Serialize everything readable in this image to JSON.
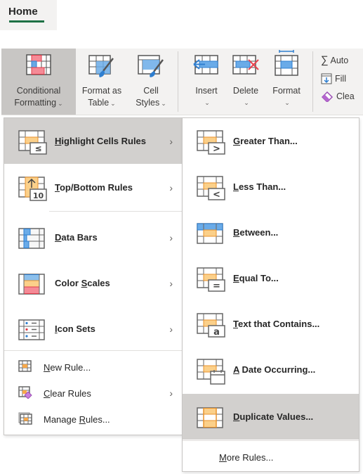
{
  "tabs": {
    "active_tab": "Home"
  },
  "ribbon": {
    "styles_group": [
      {
        "id": "conditional-formatting",
        "line1": "Conditional",
        "line2": "Formatting",
        "icon": "conditional-formatting-icon",
        "active": true
      },
      {
        "id": "format-as-table",
        "line1": "Format as",
        "line2": "Table",
        "icon": "format-as-table-icon"
      },
      {
        "id": "cell-styles",
        "line1": "Cell",
        "line2": "Styles",
        "icon": "cell-styles-icon"
      }
    ],
    "cells_group": [
      {
        "id": "insert",
        "label": "Insert",
        "icon": "insert-cells-icon"
      },
      {
        "id": "delete",
        "label": "Delete",
        "icon": "delete-cells-icon"
      },
      {
        "id": "format",
        "label": "Format",
        "icon": "format-cells-icon"
      }
    ],
    "editing_group": [
      {
        "id": "autosum",
        "label": "Auto",
        "icon": "sigma-icon"
      },
      {
        "id": "fill",
        "label": "Fill",
        "icon": "fill-down-icon"
      },
      {
        "id": "clear",
        "label": "Clea",
        "icon": "eraser-icon"
      }
    ],
    "dropdown_glyph": "⌄"
  },
  "conditional_menu": {
    "items": [
      {
        "pre": "",
        "u": "H",
        "post": "ighlight Cells Rules",
        "has_submenu": true,
        "highlighted": true,
        "icon": "highlight-cells-rules-icon"
      },
      {
        "pre": "",
        "u": "T",
        "post": "op/Bottom Rules",
        "has_submenu": true,
        "icon": "top-bottom-rules-icon"
      },
      {
        "pre": "",
        "u": "D",
        "post": "ata Bars",
        "has_submenu": true,
        "icon": "data-bars-icon"
      },
      {
        "pre": "Color ",
        "u": "S",
        "post": "cales",
        "has_submenu": true,
        "icon": "color-scales-icon"
      },
      {
        "pre": "",
        "u": "I",
        "post": "con Sets",
        "has_submenu": true,
        "icon": "icon-sets-icon"
      }
    ],
    "footer_items": [
      {
        "pre": "",
        "u": "N",
        "post": "ew Rule...",
        "has_submenu": false,
        "icon": "new-rule-icon"
      },
      {
        "pre": "",
        "u": "C",
        "post": "lear Rules",
        "has_submenu": true,
        "icon": "clear-rules-icon"
      },
      {
        "pre": "Manage ",
        "u": "R",
        "post": "ules...",
        "has_submenu": false,
        "icon": "manage-rules-icon"
      }
    ],
    "arrow_glyph": "›"
  },
  "highlight_submenu": {
    "items": [
      {
        "pre": "",
        "u": "G",
        "post": "reater Than...",
        "icon": "greater-than-icon",
        "symbol": ">"
      },
      {
        "pre": "",
        "u": "L",
        "post": "ess Than...",
        "icon": "less-than-icon",
        "symbol": "<"
      },
      {
        "pre": "",
        "u": "B",
        "post": "etween...",
        "icon": "between-icon",
        "symbol": ""
      },
      {
        "pre": "",
        "u": "E",
        "post": "qual To...",
        "icon": "equal-to-icon",
        "symbol": "="
      },
      {
        "pre": "",
        "u": "T",
        "post": "ext that Contains...",
        "icon": "text-contains-icon",
        "symbol": "a"
      },
      {
        "pre": "",
        "u": "A",
        "post": " Date Occurring...",
        "icon": "date-occurring-icon",
        "symbol": ""
      },
      {
        "pre": "",
        "u": "D",
        "post": "uplicate Values...",
        "icon": "duplicate-values-icon",
        "symbol": "",
        "highlighted": true
      }
    ],
    "footer": {
      "pre": "",
      "u": "M",
      "post": "ore Rules..."
    }
  },
  "colors": {
    "accent_green": "#1e7145",
    "hover_gray": "#d2d0ce",
    "cell_orange": "#f7b95b",
    "cell_blue": "#5ba0dc",
    "cell_red": "#f07c86"
  }
}
